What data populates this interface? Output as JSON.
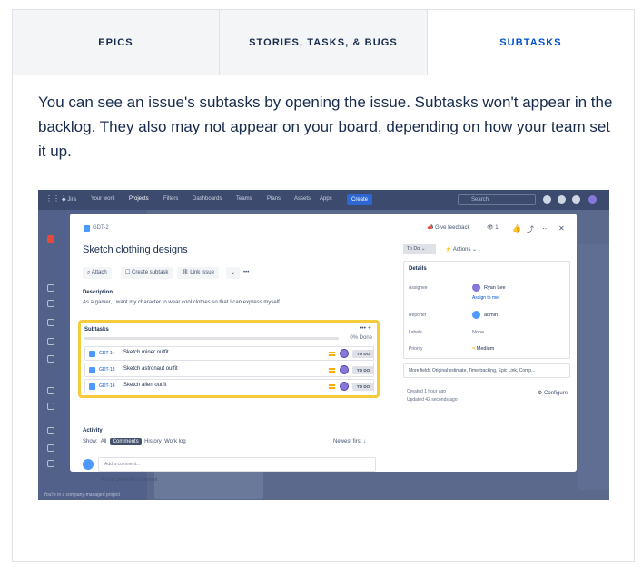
{
  "tabs": [
    {
      "label": "EPICS"
    },
    {
      "label": "STORIES, TASKS, & BUGS"
    },
    {
      "label": "SUBTASKS"
    }
  ],
  "description": "You can see an issue's subtasks by opening the issue. Subtasks won't appear in the backlog. They also may not appear on your board, depending on how your team set it up.",
  "screenshot": {
    "topnav": {
      "your_work": "Your work",
      "projects": "Projects",
      "filters": "Filters",
      "dashboards": "Dashboards",
      "teams": "Teams",
      "plans": "Plans",
      "assets": "Assets",
      "apps": "Apps",
      "create": "Create",
      "search": "Search"
    },
    "sidebar_footer": "You're in a company-managed project",
    "modal": {
      "issue_key": "GDT-2",
      "title": "Sketch clothing designs",
      "buttons": {
        "attach": "Attach",
        "create_subtask": "Create subtask",
        "link_issue": "Link issue"
      },
      "description_label": "Description",
      "description_text": "As a gamer, I want my character to wear cool clothes so that I can express myself.",
      "subtasks": {
        "label": "Subtasks",
        "done": "0% Done",
        "items": [
          {
            "key": "GDT-14",
            "name": "Sketch miner outfit",
            "status": "TO DO"
          },
          {
            "key": "GDT-15",
            "name": "Sketch astronaut outfit",
            "status": "TO DO"
          },
          {
            "key": "GDT-16",
            "name": "Sketch alien outfit",
            "status": "TO DO"
          }
        ]
      },
      "activity": {
        "label": "Activity",
        "show": "Show:",
        "all": "All",
        "comments": "Comments",
        "history": "History",
        "work_log": "Work log",
        "newest": "Newest first",
        "comment_placeholder": "Add a comment...",
        "protip": "Pro tip: press M to comment"
      },
      "right": {
        "give_feedback": "Give feedback",
        "watchers": "1",
        "status": "To Do",
        "actions": "Actions",
        "details_label": "Details",
        "assignee_k": "Assignee",
        "assignee_v": "Ryan Lee",
        "assign_to_me": "Assign to me",
        "reporter_k": "Reporter",
        "reporter_v": "admin",
        "labels_k": "Labels",
        "labels_v": "None",
        "priority_k": "Priority",
        "priority_v": "Medium",
        "more_fields": "More fields Original estimate, Time tracking, Epic Link, Comp...",
        "created": "Created 1 hour ago",
        "updated": "Updated 42 seconds ago",
        "configure": "Configure"
      }
    }
  }
}
